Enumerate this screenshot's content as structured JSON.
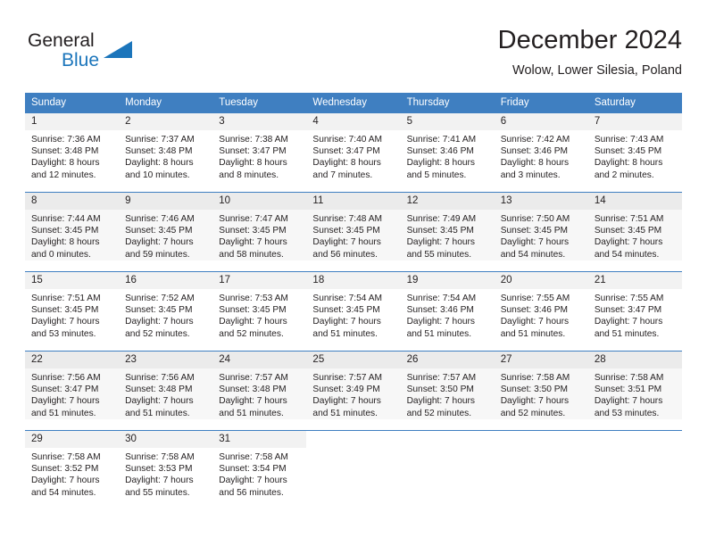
{
  "brand": {
    "name_part1": "General",
    "name_part2": "Blue",
    "logo_icon": "triangle-icon"
  },
  "header": {
    "title": "December 2024",
    "subtitle": "Wolow, Lower Silesia, Poland"
  },
  "theme": {
    "header_bg": "#3f7fc1",
    "brand_blue": "#1b75bb",
    "text": "#231f20",
    "daynum_bg": "#f2f2f2",
    "row_alt_bg": "#f7f7f7"
  },
  "calendar": {
    "weekdays": [
      "Sunday",
      "Monday",
      "Tuesday",
      "Wednesday",
      "Thursday",
      "Friday",
      "Saturday"
    ],
    "weeks": [
      [
        {
          "day": "1",
          "sunrise": "Sunrise: 7:36 AM",
          "sunset": "Sunset: 3:48 PM",
          "daylight1": "Daylight: 8 hours",
          "daylight2": "and 12 minutes."
        },
        {
          "day": "2",
          "sunrise": "Sunrise: 7:37 AM",
          "sunset": "Sunset: 3:48 PM",
          "daylight1": "Daylight: 8 hours",
          "daylight2": "and 10 minutes."
        },
        {
          "day": "3",
          "sunrise": "Sunrise: 7:38 AM",
          "sunset": "Sunset: 3:47 PM",
          "daylight1": "Daylight: 8 hours",
          "daylight2": "and 8 minutes."
        },
        {
          "day": "4",
          "sunrise": "Sunrise: 7:40 AM",
          "sunset": "Sunset: 3:47 PM",
          "daylight1": "Daylight: 8 hours",
          "daylight2": "and 7 minutes."
        },
        {
          "day": "5",
          "sunrise": "Sunrise: 7:41 AM",
          "sunset": "Sunset: 3:46 PM",
          "daylight1": "Daylight: 8 hours",
          "daylight2": "and 5 minutes."
        },
        {
          "day": "6",
          "sunrise": "Sunrise: 7:42 AM",
          "sunset": "Sunset: 3:46 PM",
          "daylight1": "Daylight: 8 hours",
          "daylight2": "and 3 minutes."
        },
        {
          "day": "7",
          "sunrise": "Sunrise: 7:43 AM",
          "sunset": "Sunset: 3:45 PM",
          "daylight1": "Daylight: 8 hours",
          "daylight2": "and 2 minutes."
        }
      ],
      [
        {
          "day": "8",
          "sunrise": "Sunrise: 7:44 AM",
          "sunset": "Sunset: 3:45 PM",
          "daylight1": "Daylight: 8 hours",
          "daylight2": "and 0 minutes."
        },
        {
          "day": "9",
          "sunrise": "Sunrise: 7:46 AM",
          "sunset": "Sunset: 3:45 PM",
          "daylight1": "Daylight: 7 hours",
          "daylight2": "and 59 minutes."
        },
        {
          "day": "10",
          "sunrise": "Sunrise: 7:47 AM",
          "sunset": "Sunset: 3:45 PM",
          "daylight1": "Daylight: 7 hours",
          "daylight2": "and 58 minutes."
        },
        {
          "day": "11",
          "sunrise": "Sunrise: 7:48 AM",
          "sunset": "Sunset: 3:45 PM",
          "daylight1": "Daylight: 7 hours",
          "daylight2": "and 56 minutes."
        },
        {
          "day": "12",
          "sunrise": "Sunrise: 7:49 AM",
          "sunset": "Sunset: 3:45 PM",
          "daylight1": "Daylight: 7 hours",
          "daylight2": "and 55 minutes."
        },
        {
          "day": "13",
          "sunrise": "Sunrise: 7:50 AM",
          "sunset": "Sunset: 3:45 PM",
          "daylight1": "Daylight: 7 hours",
          "daylight2": "and 54 minutes."
        },
        {
          "day": "14",
          "sunrise": "Sunrise: 7:51 AM",
          "sunset": "Sunset: 3:45 PM",
          "daylight1": "Daylight: 7 hours",
          "daylight2": "and 54 minutes."
        }
      ],
      [
        {
          "day": "15",
          "sunrise": "Sunrise: 7:51 AM",
          "sunset": "Sunset: 3:45 PM",
          "daylight1": "Daylight: 7 hours",
          "daylight2": "and 53 minutes."
        },
        {
          "day": "16",
          "sunrise": "Sunrise: 7:52 AM",
          "sunset": "Sunset: 3:45 PM",
          "daylight1": "Daylight: 7 hours",
          "daylight2": "and 52 minutes."
        },
        {
          "day": "17",
          "sunrise": "Sunrise: 7:53 AM",
          "sunset": "Sunset: 3:45 PM",
          "daylight1": "Daylight: 7 hours",
          "daylight2": "and 52 minutes."
        },
        {
          "day": "18",
          "sunrise": "Sunrise: 7:54 AM",
          "sunset": "Sunset: 3:45 PM",
          "daylight1": "Daylight: 7 hours",
          "daylight2": "and 51 minutes."
        },
        {
          "day": "19",
          "sunrise": "Sunrise: 7:54 AM",
          "sunset": "Sunset: 3:46 PM",
          "daylight1": "Daylight: 7 hours",
          "daylight2": "and 51 minutes."
        },
        {
          "day": "20",
          "sunrise": "Sunrise: 7:55 AM",
          "sunset": "Sunset: 3:46 PM",
          "daylight1": "Daylight: 7 hours",
          "daylight2": "and 51 minutes."
        },
        {
          "day": "21",
          "sunrise": "Sunrise: 7:55 AM",
          "sunset": "Sunset: 3:47 PM",
          "daylight1": "Daylight: 7 hours",
          "daylight2": "and 51 minutes."
        }
      ],
      [
        {
          "day": "22",
          "sunrise": "Sunrise: 7:56 AM",
          "sunset": "Sunset: 3:47 PM",
          "daylight1": "Daylight: 7 hours",
          "daylight2": "and 51 minutes."
        },
        {
          "day": "23",
          "sunrise": "Sunrise: 7:56 AM",
          "sunset": "Sunset: 3:48 PM",
          "daylight1": "Daylight: 7 hours",
          "daylight2": "and 51 minutes."
        },
        {
          "day": "24",
          "sunrise": "Sunrise: 7:57 AM",
          "sunset": "Sunset: 3:48 PM",
          "daylight1": "Daylight: 7 hours",
          "daylight2": "and 51 minutes."
        },
        {
          "day": "25",
          "sunrise": "Sunrise: 7:57 AM",
          "sunset": "Sunset: 3:49 PM",
          "daylight1": "Daylight: 7 hours",
          "daylight2": "and 51 minutes."
        },
        {
          "day": "26",
          "sunrise": "Sunrise: 7:57 AM",
          "sunset": "Sunset: 3:50 PM",
          "daylight1": "Daylight: 7 hours",
          "daylight2": "and 52 minutes."
        },
        {
          "day": "27",
          "sunrise": "Sunrise: 7:58 AM",
          "sunset": "Sunset: 3:50 PM",
          "daylight1": "Daylight: 7 hours",
          "daylight2": "and 52 minutes."
        },
        {
          "day": "28",
          "sunrise": "Sunrise: 7:58 AM",
          "sunset": "Sunset: 3:51 PM",
          "daylight1": "Daylight: 7 hours",
          "daylight2": "and 53 minutes."
        }
      ],
      [
        {
          "day": "29",
          "sunrise": "Sunrise: 7:58 AM",
          "sunset": "Sunset: 3:52 PM",
          "daylight1": "Daylight: 7 hours",
          "daylight2": "and 54 minutes."
        },
        {
          "day": "30",
          "sunrise": "Sunrise: 7:58 AM",
          "sunset": "Sunset: 3:53 PM",
          "daylight1": "Daylight: 7 hours",
          "daylight2": "and 55 minutes."
        },
        {
          "day": "31",
          "sunrise": "Sunrise: 7:58 AM",
          "sunset": "Sunset: 3:54 PM",
          "daylight1": "Daylight: 7 hours",
          "daylight2": "and 56 minutes."
        },
        {
          "day": "",
          "sunrise": "",
          "sunset": "",
          "daylight1": "",
          "daylight2": ""
        },
        {
          "day": "",
          "sunrise": "",
          "sunset": "",
          "daylight1": "",
          "daylight2": ""
        },
        {
          "day": "",
          "sunrise": "",
          "sunset": "",
          "daylight1": "",
          "daylight2": ""
        },
        {
          "day": "",
          "sunrise": "",
          "sunset": "",
          "daylight1": "",
          "daylight2": ""
        }
      ]
    ]
  }
}
